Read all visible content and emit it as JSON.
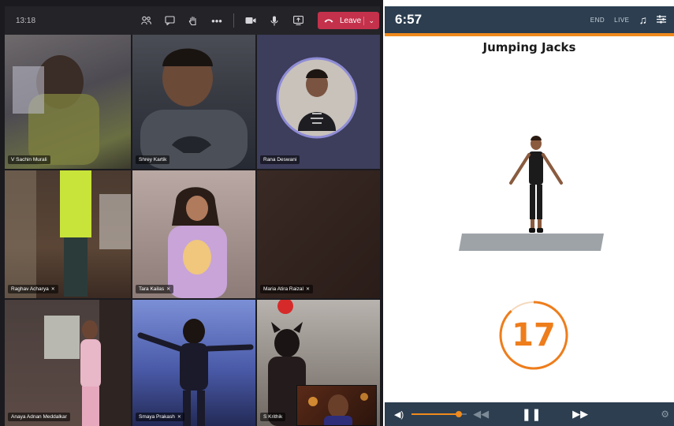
{
  "meeting": {
    "clock": "13:18",
    "toolbar": {
      "icons": [
        "participants-icon",
        "chat-icon",
        "raise-hand-icon",
        "more-icon",
        "camera-icon",
        "mic-icon",
        "share-screen-icon"
      ],
      "leave_label": "Leave"
    },
    "participants": [
      {
        "name": "V Sachin Murali"
      },
      {
        "name": "Shrey Kartik"
      },
      {
        "name": "Rana Deswani"
      },
      {
        "name": "Raghav Acharya"
      },
      {
        "name": "Tara Kailas"
      },
      {
        "name": "Maria Atira Raizal"
      },
      {
        "name": "Anaya Adnan Meddalkar"
      },
      {
        "name": "Smaya Prakash"
      },
      {
        "name": "S Krithik"
      }
    ]
  },
  "workout": {
    "timer": "6:57",
    "end_label": "END",
    "live_label": "LIVE",
    "exercise_title": "Jumping Jacks",
    "count": "17",
    "progress": 1.0,
    "counter_progress": 0.88,
    "volume_level": 0.85,
    "colors": {
      "accent": "#f08a1c",
      "bar": "#2c3e50",
      "leave": "#c4314b"
    }
  }
}
